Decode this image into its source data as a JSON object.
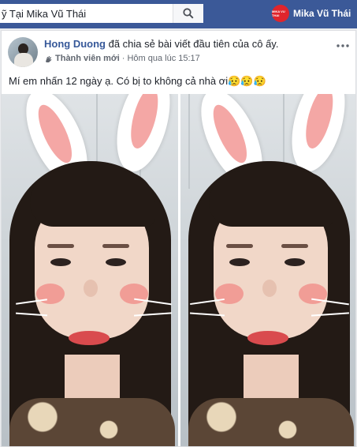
{
  "topbar": {
    "search_value": "ỹ Tại Mika Vũ Thái",
    "profile_name": "Mika Vũ Thái",
    "profile_logo_text": "MIKA VU THAI"
  },
  "post": {
    "author": "Hong Duong",
    "action": "đã chia sẻ bài viết đầu tiên của cô ấy.",
    "role": "Thành viên mới",
    "separator": "·",
    "time": "Hôm qua lúc 15:17",
    "text": "Mí em nhấn 12 ngày ạ. Có bị to không cả nhà ơi😥😥😥"
  },
  "colors": {
    "brand": "#3b5998",
    "link": "#365899",
    "logo_red": "#e0252c"
  }
}
